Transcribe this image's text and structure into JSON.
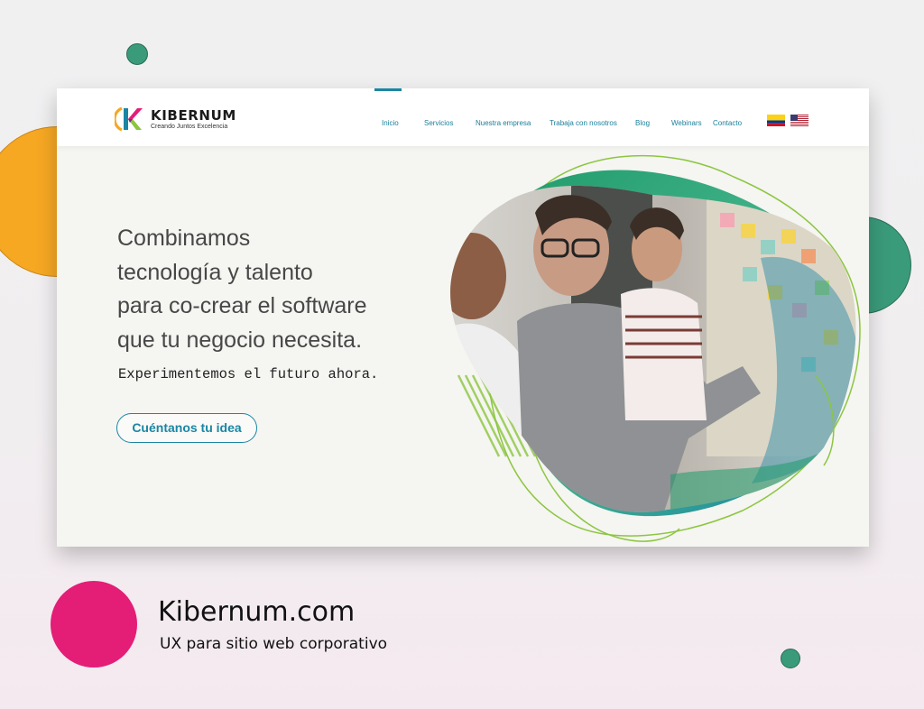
{
  "brand": {
    "name": "KIBERNUM",
    "tagline": "Creando Juntos Excelencia"
  },
  "nav": {
    "items": [
      {
        "label": "Inicio",
        "active": true
      },
      {
        "label": "Servicios"
      },
      {
        "label": "Nuestra empresa"
      },
      {
        "label": "Trabaja con nosotros"
      },
      {
        "label": "Blog"
      },
      {
        "label": "Webinars"
      },
      {
        "label": "Contacto"
      }
    ],
    "languages": [
      {
        "icon": "colombia-flag-icon"
      },
      {
        "icon": "usa-flag-icon"
      }
    ]
  },
  "hero": {
    "title_lines": [
      "Combinamos",
      "tecnología y talento",
      "para co-crear el software",
      "que tu negocio necesita."
    ],
    "subtitle": "Experimentemos el futuro ahora.",
    "cta_label": "Cuéntanos tu idea",
    "image_icon": "team-photo-icon"
  },
  "caption": {
    "title": "Kibernum.com",
    "subtitle": "UX para sitio web corporativo"
  },
  "colors": {
    "accent": "#1a86a4",
    "green": "#3a9b7a",
    "orange": "#f6a823",
    "pink": "#e41d77",
    "lime": "#8cc63f"
  }
}
